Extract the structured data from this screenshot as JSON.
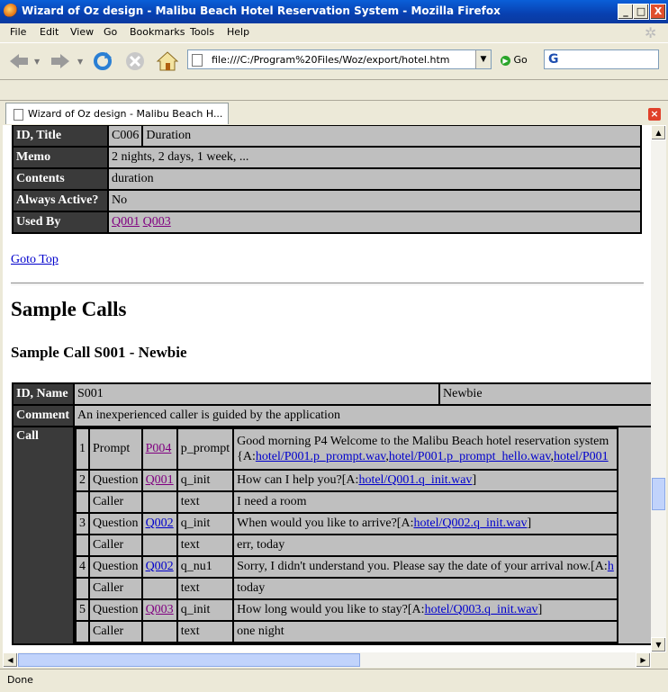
{
  "window": {
    "title": "Wizard of Oz design - Malibu Beach Hotel Reservation System - Mozilla Firefox",
    "minimize": "_",
    "maximize": "□",
    "close": "X"
  },
  "menu": [
    "File",
    "Edit",
    "View",
    "Go",
    "Bookmarks",
    "Tools",
    "Help"
  ],
  "toolbar": {
    "url": "file:///C:/Program%20Files/Woz/export/hotel.htm",
    "go_label": "Go",
    "search_value": "G"
  },
  "tab": {
    "label": "Wizard of Oz design - Malibu Beach H..."
  },
  "concept_table": {
    "id_label": "ID, Title",
    "id_value": "C006",
    "title_value": "Duration",
    "memo_label": "Memo",
    "memo_value": "2 nights, 2 days, 1 week, ...",
    "contents_label": "Contents",
    "contents_value": "duration",
    "always_active_label": "Always Active?",
    "always_active_value": "No",
    "used_by_label": "Used By",
    "used_by": [
      "Q001",
      "Q003"
    ]
  },
  "goto_top": "Goto Top",
  "sample_calls_heading": "Sample Calls",
  "sample_call_heading": "Sample Call S001 - Newbie",
  "call_table": {
    "id_label": "ID, Name",
    "id_value": "S001",
    "name_value": "Newbie",
    "comment_label": "Comment",
    "comment_value": "An inexperienced caller is guided by the application",
    "call_label": "Call",
    "rows": [
      {
        "n": "1",
        "role": "Prompt",
        "ref": "P004",
        "ref_visited": true,
        "id": "p_prompt",
        "text": "Good morning P4 Welcome to the Malibu Beach hotel reservation system",
        "text2_prefix": "{A:",
        "links": [
          "hotel/P001.p_prompt.wav",
          "hotel/P001.p_prompt_hello.wav",
          "hotel/P001"
        ]
      },
      {
        "n": "2",
        "role": "Question",
        "ref": "Q001",
        "ref_visited": true,
        "id": "q_init",
        "text": "How can I help you?[A:",
        "link": "hotel/Q001.q_init.wav",
        "suffix": "]"
      },
      {
        "n": "",
        "role": "Caller",
        "ref": "",
        "id": "text",
        "text": "I need a room"
      },
      {
        "n": "3",
        "role": "Question",
        "ref": "Q002",
        "ref_visited": false,
        "id": "q_init",
        "text": "When would you like to arrive?[A:",
        "link": "hotel/Q002.q_init.wav",
        "suffix": "]"
      },
      {
        "n": "",
        "role": "Caller",
        "ref": "",
        "id": "text",
        "text": "err, today"
      },
      {
        "n": "4",
        "role": "Question",
        "ref": "Q002",
        "ref_visited": false,
        "id": "q_nu1",
        "text": "Sorry, I didn't understand you. Please say the date of your arrival now.[A:",
        "link": "h",
        "suffix": ""
      },
      {
        "n": "",
        "role": "Caller",
        "ref": "",
        "id": "text",
        "text": "today"
      },
      {
        "n": "5",
        "role": "Question",
        "ref": "Q003",
        "ref_visited": true,
        "id": "q_init",
        "text": "How long would you like to stay?[A:",
        "link": "hotel/Q003.q_init.wav",
        "suffix": "]"
      },
      {
        "n": "",
        "role": "Caller",
        "ref": "",
        "id": "text",
        "text": "one night"
      }
    ]
  },
  "status_text": "Done"
}
